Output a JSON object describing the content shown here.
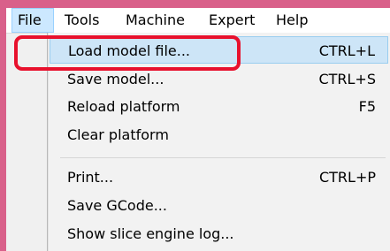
{
  "menubar": {
    "items": [
      {
        "label": "File"
      },
      {
        "label": "Tools"
      },
      {
        "label": "Machine"
      },
      {
        "label": "Expert"
      },
      {
        "label": "Help"
      }
    ]
  },
  "file_menu": {
    "items": [
      {
        "label": "Load model file...",
        "shortcut": "CTRL+L"
      },
      {
        "label": "Save model...",
        "shortcut": "CTRL+S"
      },
      {
        "label": "Reload platform",
        "shortcut": "F5"
      },
      {
        "label": "Clear platform",
        "shortcut": ""
      },
      {
        "label": "Print...",
        "shortcut": "CTRL+P"
      },
      {
        "label": "Save GCode...",
        "shortcut": ""
      },
      {
        "label": "Show slice engine log...",
        "shortcut": ""
      }
    ]
  },
  "annotation": {
    "color": "#e8112d",
    "target": "Load model file..."
  }
}
